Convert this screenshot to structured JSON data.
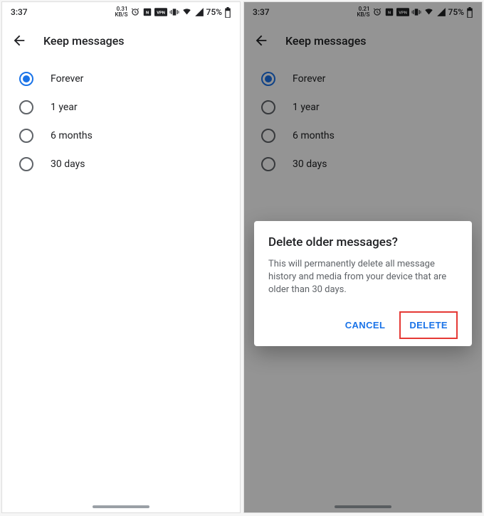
{
  "status": {
    "time": "3:37",
    "kbps_left": "0.31",
    "kbps_unit_left": "KB/S",
    "kbps_right": "0.21",
    "kbps_unit_right": "KB/S",
    "battery": "75%"
  },
  "header": {
    "title": "Keep messages"
  },
  "options": [
    {
      "label": "Forever",
      "selected": true
    },
    {
      "label": "1 year",
      "selected": false
    },
    {
      "label": "6 months",
      "selected": false
    },
    {
      "label": "30 days",
      "selected": false
    }
  ],
  "dialog": {
    "title": "Delete older messages?",
    "body": "This will permanently delete all message history and media from your device that are older than 30 days.",
    "cancel": "CANCEL",
    "confirm": "DELETE"
  }
}
